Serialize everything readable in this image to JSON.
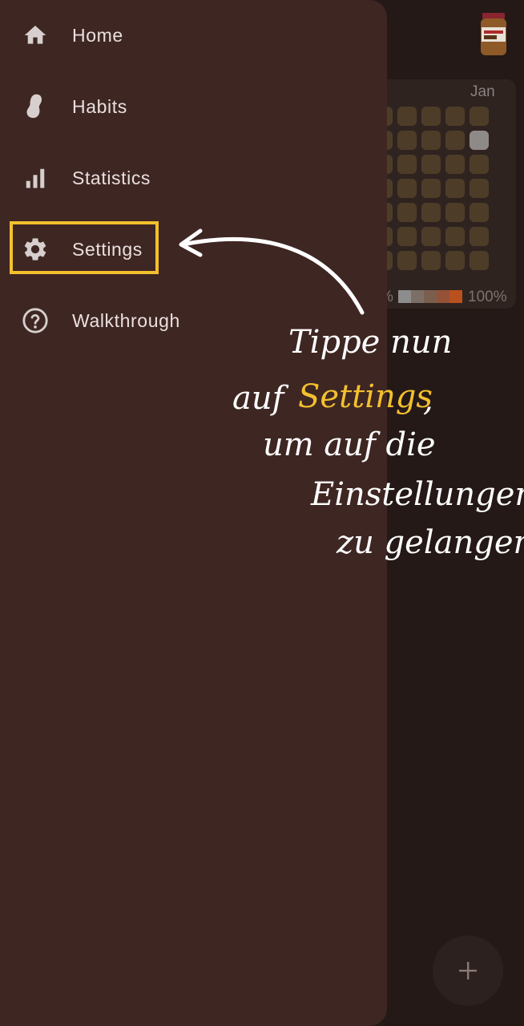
{
  "background": {
    "calendar": {
      "month_label": "Jan",
      "legend_left": "%",
      "legend_right": "100%",
      "legend_colors": [
        "#8d8d8d",
        "#7b6f68",
        "#7b5f4e",
        "#955236",
        "#b9511e"
      ]
    },
    "fab_icon": "plus-icon"
  },
  "drawer": {
    "items": [
      {
        "label": "Home",
        "icon": "home-icon"
      },
      {
        "label": "Habits",
        "icon": "habits-icon"
      },
      {
        "label": "Statistics",
        "icon": "bar-chart-icon"
      },
      {
        "label": "Settings",
        "icon": "gear-icon",
        "highlighted": true
      },
      {
        "label": "Walkthrough",
        "icon": "help-circle-icon"
      }
    ]
  },
  "annotation": {
    "lines": [
      "Tippe nun",
      "auf",
      "Settings",
      ",",
      "um auf die",
      "Einstellungen",
      "zu gelangen"
    ],
    "highlight_color": "#f3c02d"
  }
}
